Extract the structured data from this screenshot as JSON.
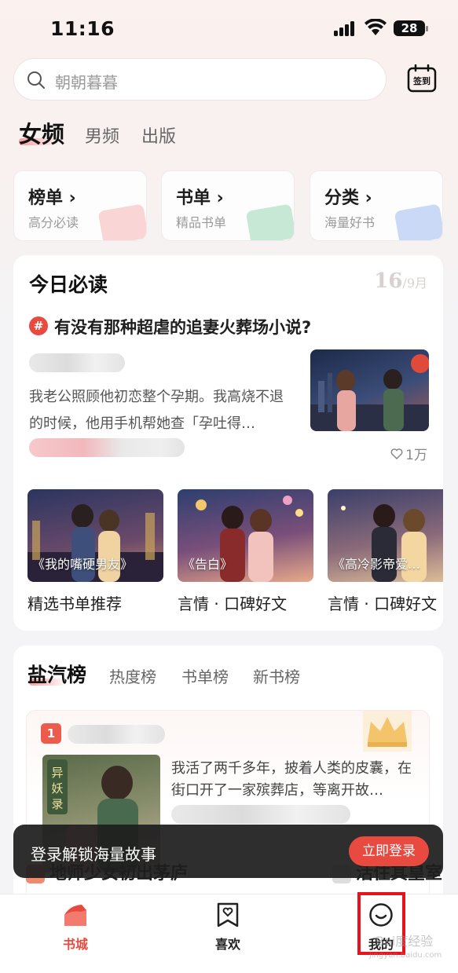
{
  "status_bar": {
    "time": "11:16",
    "battery": "28"
  },
  "search": {
    "placeholder": "朝朝暮暮"
  },
  "signin": {
    "label": "签到"
  },
  "channel_tabs": [
    {
      "label": "女频",
      "active": true
    },
    {
      "label": "男频",
      "active": false
    },
    {
      "label": "出版",
      "active": false
    }
  ],
  "quick_entries": [
    {
      "title": "榜单 ›",
      "subtitle": "高分必读",
      "color": "#f08a8a"
    },
    {
      "title": "书单 ›",
      "subtitle": "精品书单",
      "color": "#5fc08a"
    },
    {
      "title": "分类 ›",
      "subtitle": "海量好书",
      "color": "#6a98e8"
    }
  ],
  "today": {
    "title": "今日必读",
    "date_day": "16",
    "date_month": "/9月",
    "topic_badge": "#",
    "topic_title": "有没有那种超虐的追妻火葬场小说?",
    "excerpt": "我老公照顾他初恋整个孕期。我高烧不退的时候，他用手机帮她查「孕吐得…",
    "likes": "1万",
    "booklists": [
      {
        "caption": "《我的嘴硬男友》",
        "label": "精选书单推荐"
      },
      {
        "caption": "《告白》",
        "label": "言情 · 口碑好文"
      },
      {
        "caption": "《高冷影帝爱…",
        "label": "言情 · 口碑好文"
      }
    ]
  },
  "rank": {
    "tabs": [
      {
        "label": "盐汽榜",
        "active": true
      },
      {
        "label": "热度榜",
        "active": false
      },
      {
        "label": "书单榜",
        "active": false
      },
      {
        "label": "新书榜",
        "active": false
      }
    ],
    "top_item": {
      "rank": "1",
      "cover_text": "异妖录",
      "description": "我活了两千多年，披着人类的皮囊，在街口开了一家殡葬店，等离开故…"
    },
    "next_left": "地师少女初出茅庐",
    "next_right": "活住其皇室"
  },
  "login_banner": {
    "text": "登录解锁海量故事",
    "button": "立即登录"
  },
  "tabbar": [
    {
      "label": "书城",
      "active": true
    },
    {
      "label": "喜欢",
      "active": false
    },
    {
      "label": "我的",
      "active": false
    }
  ],
  "watermark": {
    "text": "Bai度经验",
    "sub": "jingyan.baidu.com"
  },
  "colors": {
    "accent": "#e84a3f",
    "highlight_box": "#e8121a"
  }
}
